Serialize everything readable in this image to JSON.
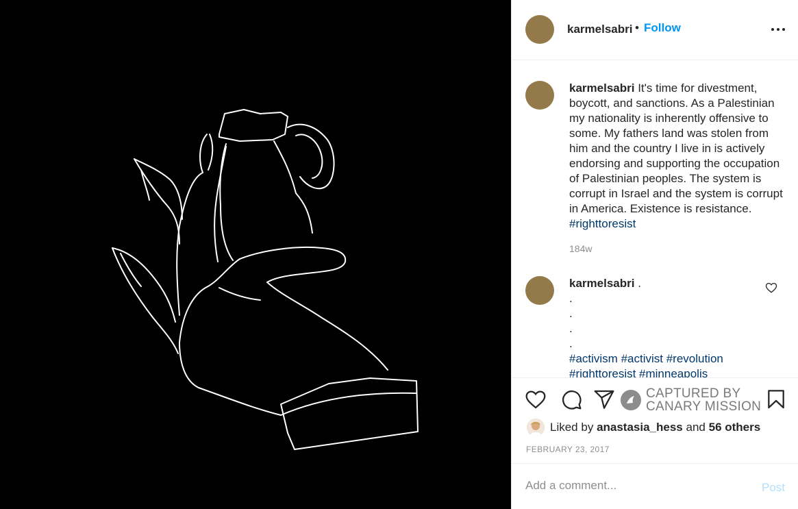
{
  "colors": {
    "avatar": "#947a4a",
    "link_blue": "#0095f6",
    "hashtag": "#00376b",
    "muted": "#8e8e8e"
  },
  "header": {
    "username": "karmelsabri",
    "separator": "•",
    "follow_label": "Follow",
    "more_icon": "more-options-icon"
  },
  "caption": {
    "username": "karmelsabri",
    "text": "It's time for divestment, boycott, and sanctions. As a Palestinian my nationality is inherently offensive to some. My fathers land was stolen from him and the country I live in is actively endorsing and supporting the occupation of Palestinian peoples. The system is corrupt in Israel and the system is corrupt in America. Existence is resistance.",
    "hashtag": "#righttoresist",
    "time_ago": "184w"
  },
  "comment": {
    "username": "karmelsabri",
    "first_line": ".",
    "dots": [
      ".",
      ".",
      ".",
      "."
    ],
    "hashtags_line1": "#activism #activist #revolution",
    "hashtags_line2": "#righttoresist #minneapolis",
    "like_icon": "heart-outline-icon"
  },
  "actions": {
    "icons": [
      "heart-icon",
      "comment-icon",
      "share-icon",
      "bookmark-icon"
    ],
    "watermark_line1": "CAPTURED BY",
    "watermark_line2": "CANARY MISSION"
  },
  "likes": {
    "prefix": "Liked by",
    "user": "anastasia_hess",
    "connector": "and",
    "others": "56 others"
  },
  "post_date": "FEBRUARY 23, 2017",
  "add_comment": {
    "placeholder": "Add a comment...",
    "post_label": "Post"
  }
}
